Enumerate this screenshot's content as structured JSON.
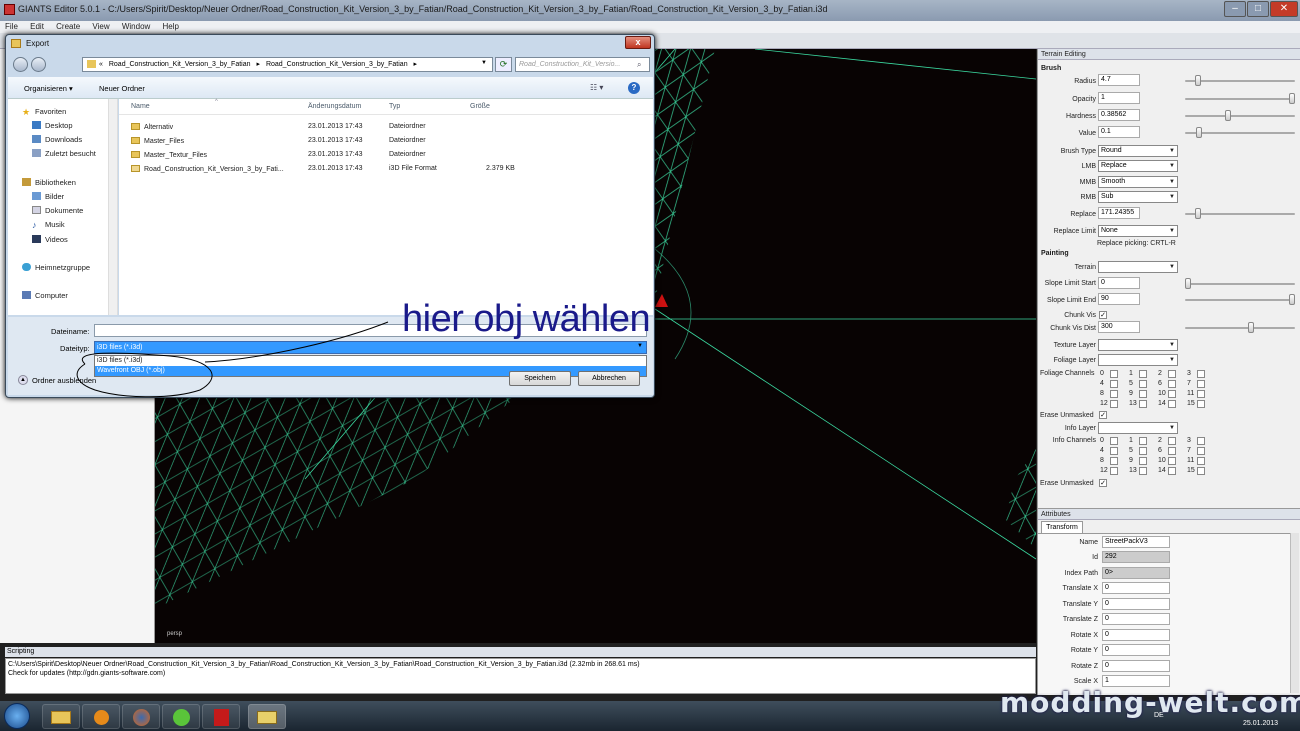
{
  "app": {
    "title": "GIANTS Editor 5.0.1 - C:/Users/Spirit/Desktop/Neuer Ordner/Road_Construction_Kit_Version_3_by_Fatian/Road_Construction_Kit_Version_3_by_Fatian/Road_Construction_Kit_Version_3_by_Fatian.i3d",
    "menu": [
      "File",
      "Edit",
      "Create",
      "View",
      "Window",
      "Help"
    ],
    "viewport_label": "persp"
  },
  "dialog": {
    "title": "Export",
    "close": "x",
    "address": {
      "prefix": "«",
      "parts": [
        "Road_Construction_Kit_Version_3_by_Fatian",
        "Road_Construction_Kit_Version_3_by_Fatian"
      ],
      "search_placeholder": "Road_Construction_Kit_Versio..."
    },
    "cmd": {
      "organize": "Organisieren ▾",
      "new_folder": "Neuer Ordner"
    },
    "nav": {
      "favorites": "Favoriten",
      "items": [
        "Desktop",
        "Downloads",
        "Zuletzt besucht"
      ],
      "libraries": "Bibliotheken",
      "lib_items": [
        "Bilder",
        "Dokumente",
        "Musik",
        "Videos"
      ],
      "homegroup": "Heimnetzgruppe",
      "computer": "Computer"
    },
    "columns": {
      "name": "Name",
      "date": "Änderungsdatum",
      "type": "Typ",
      "size": "Größe"
    },
    "files": [
      {
        "name": "Alternativ",
        "date": "23.01.2013 17:43",
        "type": "Dateiordner",
        "size": ""
      },
      {
        "name": "Master_Files",
        "date": "23.01.2013 17:43",
        "type": "Dateiordner",
        "size": ""
      },
      {
        "name": "Master_Textur_Files",
        "date": "23.01.2013 17:43",
        "type": "Dateiordner",
        "size": ""
      },
      {
        "name": "Road_Construction_Kit_Version_3_by_Fati...",
        "date": "23.01.2013 17:43",
        "type": "i3D File Format",
        "size": "2.379 KB"
      }
    ],
    "filename_label": "Dateiname:",
    "filetype_label": "Dateityp:",
    "filetype_selected": "i3D files (*.i3d)",
    "filetype_options": [
      "i3D files (*.i3d)",
      "Wavefront OBJ (*.obj)"
    ],
    "hide_folders": "Ordner ausblenden",
    "save": "Speichern",
    "cancel": "Abbrechen"
  },
  "annotation": "hier obj wählen",
  "terrain": {
    "header": "Terrain Editing",
    "brush": "Brush",
    "radius_label": "Radius",
    "radius": "4.7",
    "opacity_label": "Opacity",
    "opacity": "1",
    "hardness_label": "Hardness",
    "hardness": "0.38562",
    "value_label": "Value",
    "value": "0.1",
    "brush_type_label": "Brush Type",
    "brush_type": "Round",
    "lmb_label": "LMB",
    "lmb": "Replace",
    "mmb_label": "MMB",
    "mmb": "Smooth",
    "rmb_label": "RMB",
    "rmb": "Sub",
    "replace_label": "Replace",
    "replace": "171.24355",
    "replace_limit_label": "Replace Limit",
    "replace_limit": "None",
    "replace_picking": "Replace picking: CRTL-R",
    "painting": "Painting",
    "terrain_label": "Terrain",
    "slope_start_label": "Slope Limit Start",
    "slope_start": "0",
    "slope_end_label": "Slope Limit End",
    "slope_end": "90",
    "chunk_vis_label": "Chunk Vis",
    "chunk_vis_dist_label": "Chunk Vis Dist",
    "chunk_vis_dist": "300",
    "texture_layer_label": "Texture Layer",
    "foliage_layer_label": "Foliage Layer",
    "foliage_channels_label": "Foliage Channels",
    "erase_unmasked_label": "Erase Unmasked",
    "info_layer_label": "Info Layer",
    "info_channels_label": "Info Channels",
    "channels": [
      "0",
      "1",
      "2",
      "3",
      "4",
      "5",
      "6",
      "7",
      "8",
      "9",
      "10",
      "11",
      "12",
      "13",
      "14",
      "15"
    ]
  },
  "attributes": {
    "header": "Attributes",
    "tab": "Transform",
    "fields": [
      {
        "label": "Name",
        "value": "StreetPackV3"
      },
      {
        "label": "Id",
        "value": "292"
      },
      {
        "label": "Index Path",
        "value": "0>"
      },
      {
        "label": "Translate X",
        "value": "0"
      },
      {
        "label": "Translate Y",
        "value": "0"
      },
      {
        "label": "Translate Z",
        "value": "0"
      },
      {
        "label": "Rotate X",
        "value": "0"
      },
      {
        "label": "Rotate Y",
        "value": "0"
      },
      {
        "label": "Rotate Z",
        "value": "0"
      },
      {
        "label": "Scale X",
        "value": "1"
      }
    ]
  },
  "scripting": {
    "header": "Scripting",
    "line1": "C:\\Users\\Spirit\\Desktop\\Neuer Ordner\\Road_Construction_Kit_Version_3_by_Fatian\\Road_Construction_Kit_Version_3_by_Fatian\\Road_Construction_Kit_Version_3_by_Fatian.i3d (2.32mb in 268.61 ms)",
    "line2": "Check for updates (http://gdn.giants-software.com)"
  },
  "taskbar": {
    "lang": "DE",
    "date": "25.01.2013"
  },
  "watermark": "modding-welt.com"
}
